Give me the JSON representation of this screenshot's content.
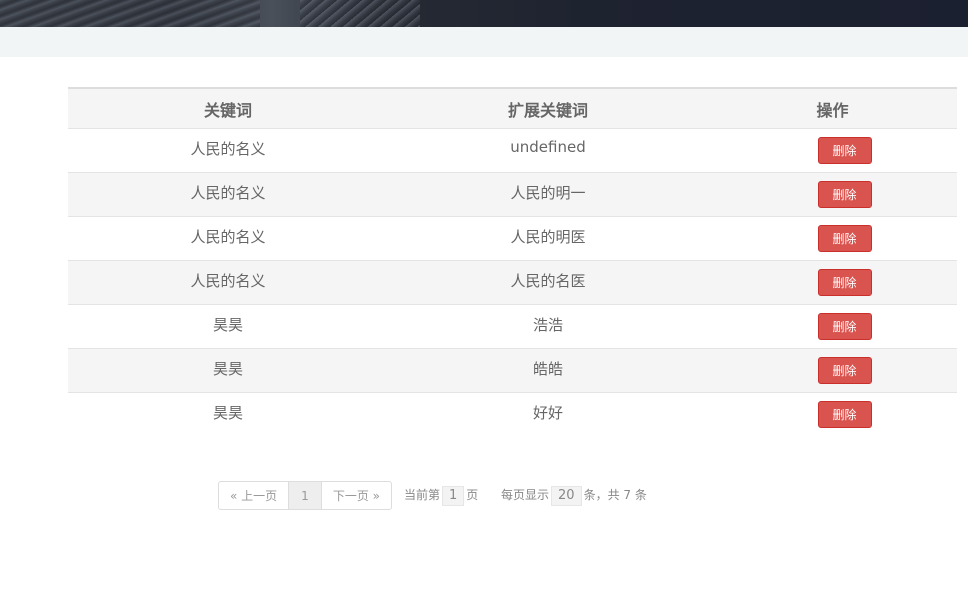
{
  "table": {
    "headers": [
      "关键词",
      "扩展关键词",
      "操作"
    ],
    "rows": [
      {
        "keyword": "人民的名义",
        "extended": "undefined",
        "action": "删除"
      },
      {
        "keyword": "人民的名义",
        "extended": "人民的明一",
        "action": "删除"
      },
      {
        "keyword": "人民的名义",
        "extended": "人民的明医",
        "action": "删除"
      },
      {
        "keyword": "人民的名义",
        "extended": "人民的名医",
        "action": "删除"
      },
      {
        "keyword": "昊昊",
        "extended": "浩浩",
        "action": "删除"
      },
      {
        "keyword": "昊昊",
        "extended": "皓皓",
        "action": "删除"
      },
      {
        "keyword": "昊昊",
        "extended": "好好",
        "action": "删除"
      }
    ]
  },
  "pagination": {
    "prev_label": "« 上一页",
    "page": "1",
    "next_label": "下一页 »",
    "current_prefix": "当前第",
    "current_value": "1",
    "current_suffix": "页",
    "per_page_prefix": "每页显示",
    "per_page_value": "20",
    "per_page_suffix": "条，共 7 条"
  },
  "colors": {
    "danger": "#d9534f",
    "stripe": "#f5f5f5",
    "subbar": "#f1f5f5"
  }
}
